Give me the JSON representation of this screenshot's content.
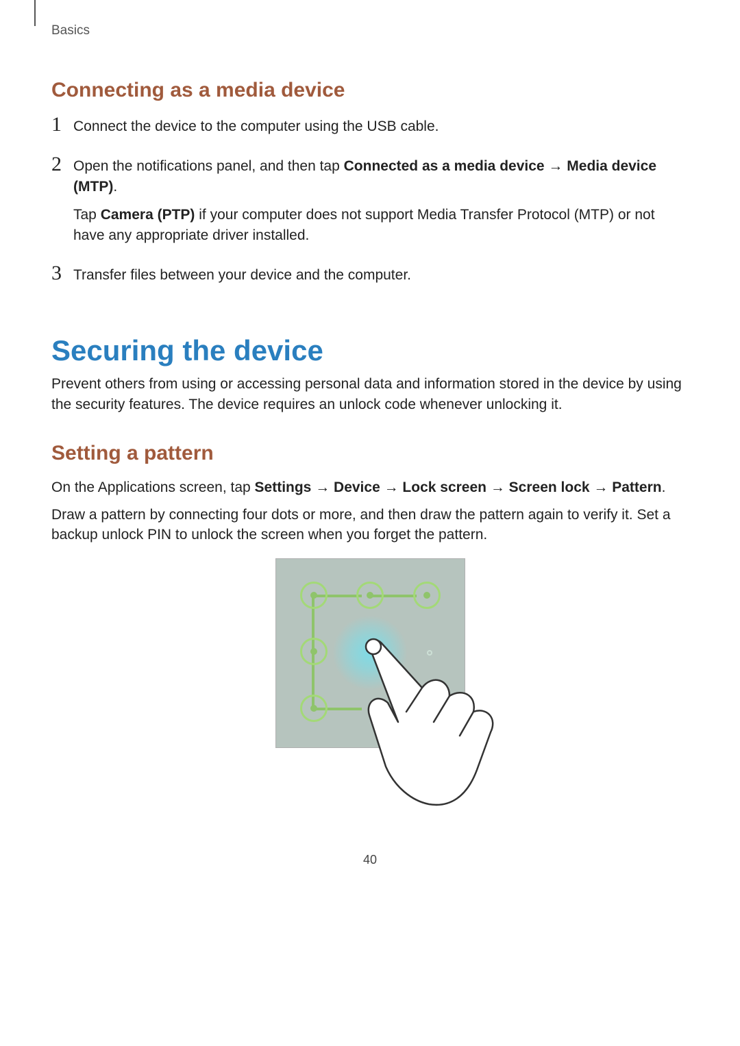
{
  "header": {
    "section": "Basics"
  },
  "s1": {
    "heading": "Connecting as a media device",
    "step1_num": "1",
    "step1_text": "Connect the device to the computer using the USB cable.",
    "step2_num": "2",
    "step2_line_pre": "Open the notifications panel, and then tap ",
    "step2_bold1": "Connected as a media device",
    "step2_arrow": " → ",
    "step2_bold2": "Media device (MTP)",
    "step2_period": ".",
    "step2_note_pre": "Tap ",
    "step2_note_bold": "Camera (PTP)",
    "step2_note_post": " if your computer does not support Media Transfer Protocol (MTP) or not have any appropriate driver installed.",
    "step3_num": "3",
    "step3_text": "Transfer files between your device and the computer."
  },
  "s2": {
    "heading": "Securing the device",
    "intro": "Prevent others from using or accessing personal data and information stored in the device by using the security features. The device requires an unlock code whenever unlocking it."
  },
  "s3": {
    "heading": "Setting a pattern",
    "line1_pre": "On the Applications screen, tap ",
    "b1": "Settings",
    "a1": " → ",
    "b2": "Device",
    "a2": " → ",
    "b3": "Lock screen",
    "a3": " → ",
    "b4": "Screen lock",
    "a4": " → ",
    "b5": "Pattern",
    "period": ".",
    "line2": "Draw a pattern by connecting four dots or more, and then draw the pattern again to verify it. Set a backup unlock PIN to unlock the screen when you forget the pattern."
  },
  "page_number": "40"
}
